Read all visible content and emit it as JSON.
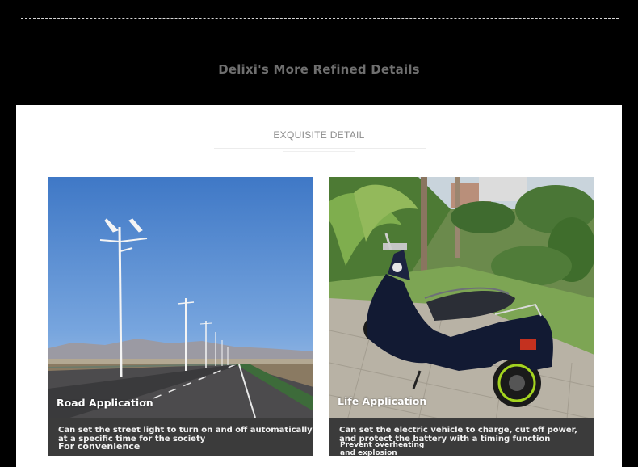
{
  "header": {
    "title": "Delixi's More Refined Details"
  },
  "section": {
    "subtitle": "EXQUISITE DETAIL"
  },
  "cards": [
    {
      "title": "Road Application",
      "line1": "Can set the street light to turn on and off automatically",
      "line2": " at a specific time for the society",
      "line3": "For convenience",
      "image": "street-lights-highway-photo"
    },
    {
      "title": "Life Application",
      "line1": "Can set the electric vehicle to charge, cut off power,",
      "line2": " and protect the battery with a timing function",
      "line3": "Prevent overheating",
      "line4": " and explosion",
      "image": "electric-scooter-photo"
    }
  ]
}
